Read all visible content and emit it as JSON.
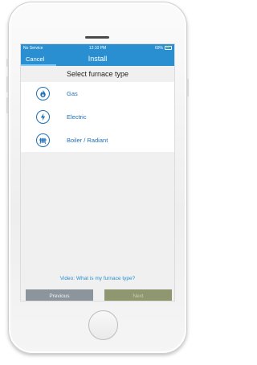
{
  "statusbar": {
    "carrier": "No Service",
    "time": "12:10 PM",
    "battery": "69%"
  },
  "navbar": {
    "cancel_label": "Cancel",
    "title": "Install"
  },
  "section_title": "Select furnace type",
  "furnace_types": [
    {
      "label": "Gas",
      "icon": "flame-icon"
    },
    {
      "label": "Electric",
      "icon": "lightning-icon"
    },
    {
      "label": "Boiler / Radiant",
      "icon": "radiator-icon"
    }
  ],
  "video_link": "Video: What is my furnace type?",
  "buttons": {
    "previous": "Previous",
    "next": "Next"
  },
  "colors": {
    "accent": "#2a8fd0",
    "icon_blue": "#1e6fb5",
    "previous_button": "#8c959c",
    "next_button": "#8f9770"
  }
}
